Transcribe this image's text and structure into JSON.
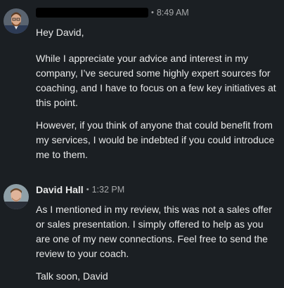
{
  "messages": [
    {
      "sender": "",
      "time": "8:49 AM",
      "paragraphs": [
        "Hey David,",
        "While I appreciate your advice and interest in my company, I’ve secured some highly expert sources for coaching, and I have to focus on a few key initiatives at this point.",
        "However, if you think of anyone that could benefit from my services, I would be indebted if you could introduce me to them."
      ]
    },
    {
      "sender": "David Hall",
      "time": "1:32 PM",
      "paragraphs": [
        "As I mentioned in my review, this was not a sales offer or sales presentation. I simply offered to help as you are one of my new connections. Feel free to send the review to your coach.",
        "Talk soon, David"
      ]
    }
  ],
  "separator": "•",
  "colors": {
    "background": "#1b1f23",
    "text": "#e6e6e6",
    "meta": "#9a9a9a",
    "redaction": "#000000"
  }
}
